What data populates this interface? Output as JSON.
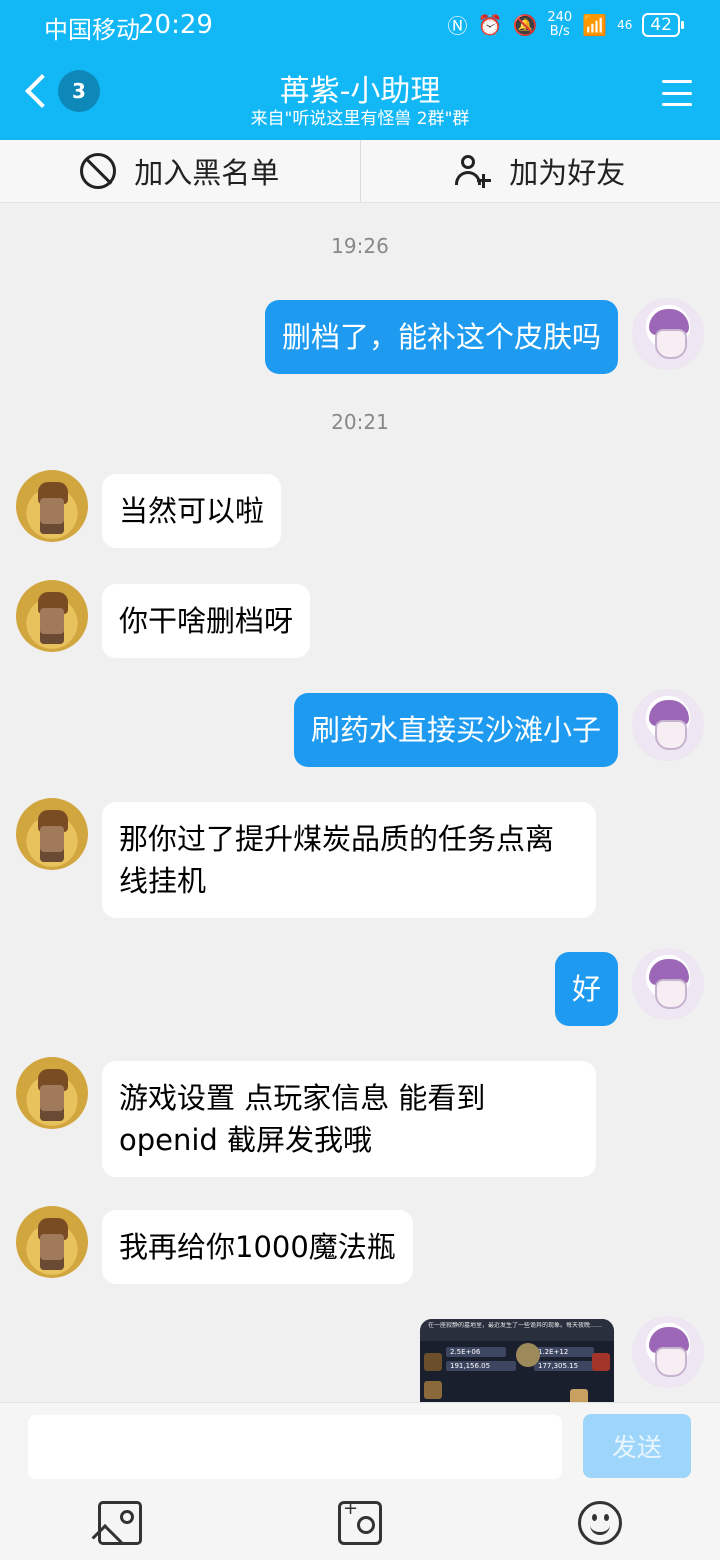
{
  "status_bar": {
    "carrier": "中国移动",
    "time": "20:29",
    "speed_value": "240",
    "speed_unit": "B/s",
    "network": "46",
    "battery": "42"
  },
  "header": {
    "back_badge": "3",
    "title": "苒紫-小助理",
    "subtitle": "来自\"听说这里有怪兽 2群\"群"
  },
  "actions": {
    "block_label": "加入黑名单",
    "add_friend_label": "加为好友"
  },
  "messages": [
    {
      "type": "time",
      "text": "19:26"
    },
    {
      "type": "text",
      "from": "me",
      "text": "删档了，能补这个皮肤吗"
    },
    {
      "type": "time",
      "text": "20:21"
    },
    {
      "type": "text",
      "from": "them",
      "text": "当然可以啦"
    },
    {
      "type": "text",
      "from": "them",
      "text": "你干啥删档呀"
    },
    {
      "type": "text",
      "from": "me",
      "text": "刷药水直接买沙滩小子"
    },
    {
      "type": "text",
      "from": "them",
      "text": "那你过了提升煤炭品质的任务点离线挂机",
      "lines": [
        "那你过了提升煤炭品质的任务点离",
        "线挂机"
      ]
    },
    {
      "type": "text",
      "from": "me",
      "text": "好"
    },
    {
      "type": "text",
      "from": "them",
      "text": "游戏设置 点玩家信息 能看到 openid 截屏发我哦",
      "lines": [
        "游戏设置 点玩家信息 能看到",
        "openid 截屏发我哦"
      ]
    },
    {
      "type": "text",
      "from": "them",
      "text": "我再给你1000魔法瓶"
    },
    {
      "type": "image",
      "from": "me",
      "caption": "在一座寂静的墓地里，最近发生了一些诡异的现象。每天夜晚……",
      "values": [
        "2.5E+06",
        "1.2E+12",
        "191,156.05",
        "177,305.15"
      ]
    }
  ],
  "input": {
    "placeholder": "",
    "send_label": "发送"
  },
  "colors": {
    "header": "#12b7f5",
    "my_bubble": "#1e9bf0",
    "their_bubble": "#ffffff",
    "send_disabled": "#9dd6fa"
  },
  "icons": {
    "back": "chevron-left-icon",
    "menu": "hamburger-menu-icon",
    "block": "block-icon",
    "add_friend": "add-user-icon",
    "photo": "photo-icon",
    "camera": "camera-icon",
    "emoji": "emoji-icon"
  }
}
